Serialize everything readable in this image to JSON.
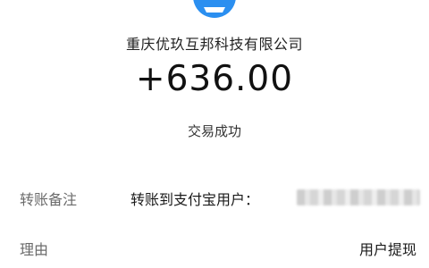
{
  "merchant": {
    "name": "重庆优玖互邦科技有限公司"
  },
  "transaction": {
    "amount": "+636.00",
    "status": "交易成功"
  },
  "details": {
    "remark_label": "转账备注",
    "remark_value": "转账到支付宝用户：",
    "reason_label": "理由",
    "reason_value": "用户提现"
  },
  "colors": {
    "avatar": "#2b8ff0"
  }
}
